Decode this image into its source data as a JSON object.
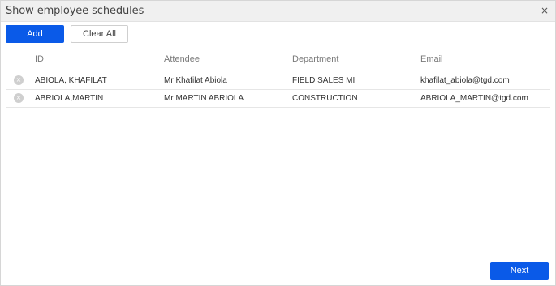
{
  "dialog": {
    "title": "Show employee schedules",
    "close_icon": "×"
  },
  "toolbar": {
    "add_label": "Add",
    "clear_all_label": "Clear All"
  },
  "table": {
    "headers": [
      "ID",
      "Attendee",
      "Department",
      "Email"
    ],
    "rows": [
      {
        "id": "ABIOLA, KHAFILAT",
        "attendee": "Mr Khafilat Abiola",
        "department": "FIELD SALES MI",
        "email": "khafilat_abiola@tgd.com"
      },
      {
        "id": "ABRIOLA,MARTIN",
        "attendee": "Mr MARTIN ABRIOLA",
        "department": "CONSTRUCTION",
        "email": "ABRIOLA_MARTIN@tgd.com"
      }
    ],
    "remove_icon": "×"
  },
  "footer": {
    "next_label": "Next"
  },
  "colors": {
    "primary": "#0a5ae8",
    "titlebar": "#f0f0f0"
  }
}
